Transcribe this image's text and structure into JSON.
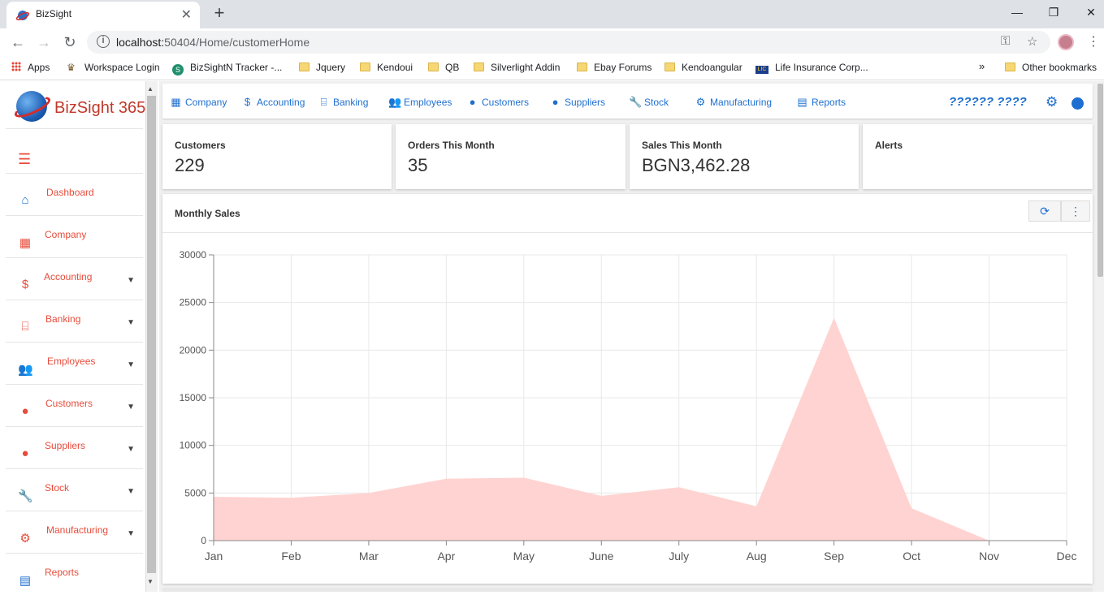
{
  "browser": {
    "tab_title": "BizSight",
    "url_host": "localhost:",
    "url_rest": "50404/Home/customerHome",
    "bookmarks": [
      {
        "label": "Apps",
        "type": "apps"
      },
      {
        "label": "Workspace Login",
        "type": "site"
      },
      {
        "label": "BizSightN Tracker -...",
        "type": "site"
      },
      {
        "label": "Jquery",
        "type": "folder"
      },
      {
        "label": "Kendoui",
        "type": "folder"
      },
      {
        "label": "QB",
        "type": "folder"
      },
      {
        "label": "Silverlight Addin",
        "type": "folder"
      },
      {
        "label": "Ebay Forums",
        "type": "folder"
      },
      {
        "label": "Kendoangular",
        "type": "folder"
      },
      {
        "label": "Life Insurance Corp...",
        "type": "site"
      }
    ],
    "overflow": "»",
    "other_bookmarks": "Other bookmarks"
  },
  "logo": {
    "text": "BizSight 365"
  },
  "sidebar": {
    "items": [
      {
        "label": "Dashboard",
        "icon": "home-icon",
        "glyph": "⌂",
        "color": "#1e6fd0",
        "caret": false
      },
      {
        "label": "Company",
        "icon": "building-icon",
        "glyph": "▦",
        "color": "#e74c3c",
        "caret": false
      },
      {
        "label": "Accounting",
        "icon": "dollar-icon",
        "glyph": "$",
        "color": "#e74c3c",
        "caret": true
      },
      {
        "label": "Banking",
        "icon": "bank-icon",
        "glyph": "⌸",
        "color": "#e74c3c",
        "caret": true
      },
      {
        "label": "Employees",
        "icon": "people-icon",
        "glyph": "👥",
        "color": "#1e6fd0",
        "caret": true
      },
      {
        "label": "Customers",
        "icon": "users-icon",
        "glyph": "●",
        "color": "#e74c3c",
        "caret": true
      },
      {
        "label": "Suppliers",
        "icon": "user-icon",
        "glyph": "●",
        "color": "#e74c3c",
        "caret": true
      },
      {
        "label": "Stock",
        "icon": "wrench-icon",
        "glyph": "🔧",
        "color": "#e74c3c",
        "caret": true
      },
      {
        "label": "Manufacturing",
        "icon": "cogs-icon",
        "glyph": "⚙",
        "color": "#e74c3c",
        "caret": true
      },
      {
        "label": "Reports",
        "icon": "chart-icon",
        "glyph": "▤",
        "color": "#1e6fd0",
        "caret": false
      }
    ]
  },
  "topnav": {
    "items": [
      {
        "label": "Company",
        "icon": "building-icon",
        "glyph": "▦"
      },
      {
        "label": "Accounting",
        "icon": "dollar-icon",
        "glyph": "$"
      },
      {
        "label": "Banking",
        "icon": "bank-icon",
        "glyph": "⌸"
      },
      {
        "label": "Employees",
        "icon": "people-icon",
        "glyph": "👥"
      },
      {
        "label": "Customers",
        "icon": "users-icon",
        "glyph": "●"
      },
      {
        "label": "Suppliers",
        "icon": "user-icon",
        "glyph": "●"
      },
      {
        "label": "Stock",
        "icon": "wrench-icon",
        "glyph": "🔧"
      },
      {
        "label": "Manufacturing",
        "icon": "cogs-icon",
        "glyph": "⚙"
      },
      {
        "label": "Reports",
        "icon": "chart-icon",
        "glyph": "▤"
      }
    ],
    "user": "?????? ????"
  },
  "cards": [
    {
      "label": "Customers",
      "value": "229"
    },
    {
      "label": "Orders This Month",
      "value": "35"
    },
    {
      "label": "Sales This Month",
      "value": "BGN3,462.28"
    },
    {
      "label": "Alerts",
      "value": ""
    }
  ],
  "panel": {
    "title": "Monthly Sales"
  },
  "chart_data": {
    "type": "area",
    "title": "",
    "categories": [
      "Jan",
      "Feb",
      "Mar",
      "Apr",
      "May",
      "June",
      "July",
      "Aug",
      "Sep",
      "Oct",
      "Nov",
      "Dec"
    ],
    "series": [
      {
        "values": [
          4600,
          4500,
          5000,
          6500,
          6600,
          4700,
          5600,
          3600,
          23400,
          3400,
          0,
          null
        ],
        "color": "#ffd3d1"
      }
    ],
    "ylim": [
      0,
      30000
    ],
    "yticks": [
      0,
      5000,
      10000,
      15000,
      20000,
      25000,
      30000
    ],
    "grid": true
  }
}
